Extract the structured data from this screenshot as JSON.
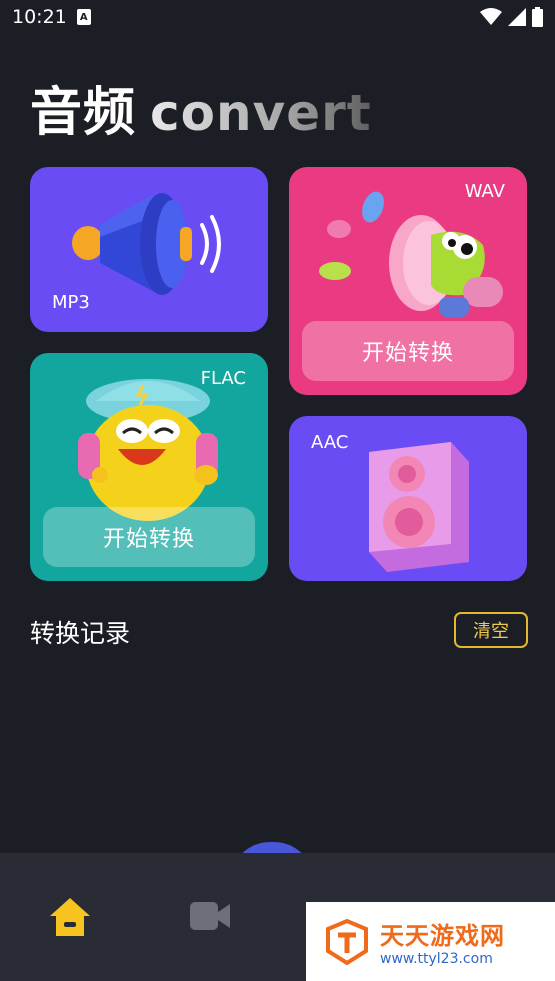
{
  "status_bar": {
    "time": "10:21",
    "notification_icon": "a-notification-icon",
    "icons": [
      "wifi-icon",
      "signal-icon",
      "battery-icon"
    ]
  },
  "header": {
    "title_cn": "音频",
    "title_en": "convert"
  },
  "cards": {
    "mp3": {
      "label": "MP3",
      "color": "#6a4cf5",
      "illustration": "speaker-horn-icon"
    },
    "wav": {
      "label": "WAV",
      "color": "#ea3b82",
      "button": "开始转换",
      "illustration": "frog-horn-icon"
    },
    "flac": {
      "label": "FLAC",
      "color": "#12a69e",
      "button": "开始转换",
      "illustration": "smiling-character-headphones-icon"
    },
    "aac": {
      "label": "AAC",
      "color": "#6a4cf5",
      "illustration": "loudspeaker-box-icon"
    }
  },
  "records": {
    "title": "转换记录",
    "clear_button": "清空"
  },
  "bottom_nav": {
    "items": [
      {
        "icon": "home-icon",
        "active": true
      },
      {
        "icon": "video-icon",
        "active": false
      }
    ],
    "accent": "#f7c41f"
  },
  "watermark": {
    "title": "天天游戏网",
    "url": "www.ttyl23.com"
  }
}
